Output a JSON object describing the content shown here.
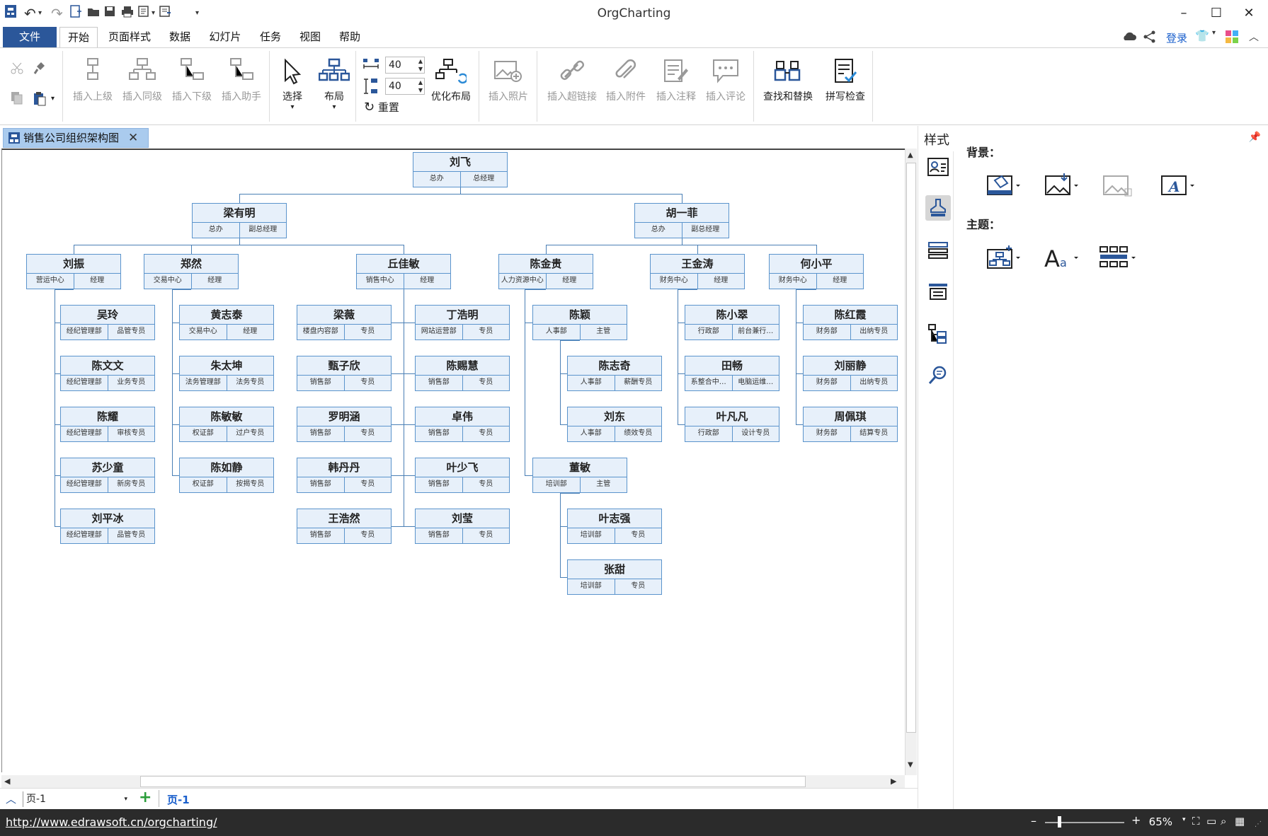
{
  "app": {
    "title": "OrgCharting"
  },
  "tabs": [
    {
      "label": "文件"
    },
    {
      "label": "开始"
    },
    {
      "label": "页面样式"
    },
    {
      "label": "数据"
    },
    {
      "label": "幻灯片"
    },
    {
      "label": "任务"
    },
    {
      "label": "视图"
    },
    {
      "label": "帮助"
    }
  ],
  "account": {
    "login": "登录"
  },
  "ribbon": {
    "insert_superior": "插入上级",
    "insert_peer": "插入同级",
    "insert_subordinate": "插入下级",
    "insert_assistant": "插入助手",
    "select": "选择",
    "layout": "布局",
    "spacing_h": "40",
    "spacing_v": "40",
    "reset": "重置",
    "optimize_layout": "优化布局",
    "insert_photo": "插入照片",
    "insert_hyperlink": "插入超链接",
    "insert_attachment": "插入附件",
    "insert_note": "插入注释",
    "insert_comment": "插入评论",
    "find_replace": "查找和替换",
    "spell_check": "拼写检查"
  },
  "document": {
    "tab_title": "销售公司组织架构图"
  },
  "org": [
    {
      "name": "刘飞",
      "dept": "总办",
      "title": "总经理"
    },
    {
      "name": "梁有明",
      "dept": "总办",
      "title": "副总经理"
    },
    {
      "name": "胡一菲",
      "dept": "总办",
      "title": "副总经理"
    },
    {
      "name": "刘振",
      "dept": "营运中心",
      "title": "经理"
    },
    {
      "name": "郑然",
      "dept": "交易中心",
      "title": "经理"
    },
    {
      "name": "丘佳敏",
      "dept": "销售中心",
      "title": "经理"
    },
    {
      "name": "陈金贵",
      "dept": "人力资源中心",
      "title": "经理"
    },
    {
      "name": "王金涛",
      "dept": "财务中心",
      "title": "经理"
    },
    {
      "name": "何小平",
      "dept": "财务中心",
      "title": "经理"
    },
    {
      "name": "吴玲",
      "dept": "经纪管理部",
      "title": "品管专员"
    },
    {
      "name": "陈文文",
      "dept": "经纪管理部",
      "title": "业务专员"
    },
    {
      "name": "陈耀",
      "dept": "经纪管理部",
      "title": "审核专员"
    },
    {
      "name": "苏少童",
      "dept": "经纪管理部",
      "title": "新房专员"
    },
    {
      "name": "刘平冰",
      "dept": "经纪管理部",
      "title": "品管专员"
    },
    {
      "name": "黄志泰",
      "dept": "交易中心",
      "title": "经理"
    },
    {
      "name": "朱太坤",
      "dept": "法务管理部",
      "title": "法务专员"
    },
    {
      "name": "陈敏敏",
      "dept": "权证部",
      "title": "过户专员"
    },
    {
      "name": "陈如静",
      "dept": "权证部",
      "title": "按揭专员"
    },
    {
      "name": "梁薇",
      "dept": "楼盘内容部",
      "title": "专员"
    },
    {
      "name": "甄子欣",
      "dept": "销售部",
      "title": "专员"
    },
    {
      "name": "罗明涵",
      "dept": "销售部",
      "title": "专员"
    },
    {
      "name": "韩丹丹",
      "dept": "销售部",
      "title": "专员"
    },
    {
      "name": "王浩然",
      "dept": "销售部",
      "title": "专员"
    },
    {
      "name": "丁浩明",
      "dept": "网站运营部",
      "title": "专员"
    },
    {
      "name": "陈赐慧",
      "dept": "销售部",
      "title": "专员"
    },
    {
      "name": "卓伟",
      "dept": "销售部",
      "title": "专员"
    },
    {
      "name": "叶少飞",
      "dept": "销售部",
      "title": "专员"
    },
    {
      "name": "刘莹",
      "dept": "销售部",
      "title": "专员"
    },
    {
      "name": "陈颖",
      "dept": "人事部",
      "title": "主管"
    },
    {
      "name": "陈志奇",
      "dept": "人事部",
      "title": "薪酬专员"
    },
    {
      "name": "刘东",
      "dept": "人事部",
      "title": "绩效专员"
    },
    {
      "name": "董敏",
      "dept": "培训部",
      "title": "主管"
    },
    {
      "name": "叶志强",
      "dept": "培训部",
      "title": "专员"
    },
    {
      "name": "张甜",
      "dept": "培训部",
      "title": "专员"
    },
    {
      "name": "陈小翠",
      "dept": "行政部",
      "title": "前台兼行…"
    },
    {
      "name": "田畅",
      "dept": "系整合中…",
      "title": "电脑运维…"
    },
    {
      "name": "叶凡凡",
      "dept": "行政部",
      "title": "设计专员"
    },
    {
      "name": "陈红霞",
      "dept": "财务部",
      "title": "出纳专员"
    },
    {
      "name": "刘丽静",
      "dept": "财务部",
      "title": "出纳专员"
    },
    {
      "name": "周佩琪",
      "dept": "财务部",
      "title": "结算专员"
    }
  ],
  "side_panel": {
    "title": "样式",
    "background_label": "背景：",
    "theme_label": "主题："
  },
  "pages": {
    "current_select": "页-1",
    "active_tab": "页-1"
  },
  "status": {
    "url": "http://www.edrawsoft.cn/orgcharting/",
    "zoom": "65%"
  }
}
